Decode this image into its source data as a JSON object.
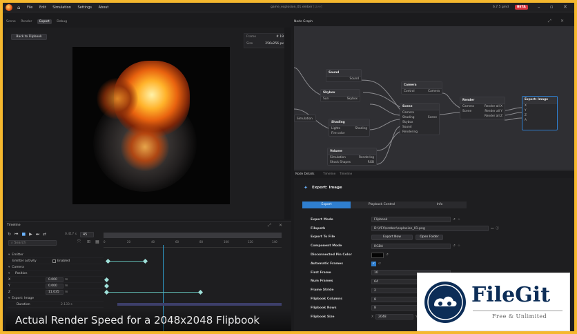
{
  "titlebar": {
    "menu": [
      "File",
      "Edit",
      "Simulation",
      "Settings",
      "About"
    ],
    "file_title": "game_explosion_01.ember",
    "file_suffix": "[Live]",
    "version": "6.7.5 gmd",
    "beta": "BETA"
  },
  "left_tabs": [
    "Scene",
    "Render",
    "Export",
    "Debug"
  ],
  "active_left_tab": "Export",
  "preview": {
    "back_label": "Back to Flipbook",
    "frame_label": "Frame",
    "frame_value": "# 19",
    "size_label": "Size",
    "size_value": "256x256 px"
  },
  "node_graph": {
    "tab": "Node Graph",
    "nodes": {
      "sound": {
        "title": "Sound",
        "rows": [
          "Sound"
        ]
      },
      "skybox": {
        "title": "Skybox",
        "rows": [
          "Sun",
          "Skybox"
        ]
      },
      "camera": {
        "title": "Camera",
        "rows": [
          "Control",
          "Camera"
        ]
      },
      "render": {
        "title": "Render",
        "rows": [
          "Camera",
          "Render all X",
          "Scene",
          "Render all Y",
          "Render all Z"
        ]
      },
      "export_image": {
        "title": "Export: Image",
        "rows": [
          "X",
          "Y",
          "Z",
          "A"
        ]
      },
      "scene": {
        "title": "Scene",
        "rows": [
          "Camera",
          "Shading",
          "Scene",
          "Skybox",
          "Sound",
          "Rendering"
        ]
      },
      "shading": {
        "title": "Shading",
        "rows": [
          "Lights",
          "Shading",
          "Fire color"
        ]
      },
      "volume": {
        "title": "Volume",
        "rows": [
          "Simulation",
          "Rendering",
          "Shock Shapes",
          "RGB"
        ]
      },
      "left_stub": {
        "title": "",
        "rows": [
          "Simulation"
        ]
      }
    }
  },
  "details_tabs": [
    "Node Details",
    "Timeline",
    "Timeline"
  ],
  "details": {
    "header": "Export: Image",
    "tabs": [
      "Export",
      "Playback Control",
      "Info"
    ],
    "rows": [
      {
        "label": "Export Mode",
        "value": "Flipbook"
      },
      {
        "label": "Filepath",
        "value": "D:\\VFX\\ember\\explosion_01.png"
      },
      {
        "label": "Export To File",
        "btn1": "Export Now",
        "btn2": "Open Folder"
      },
      {
        "label": "Component Mode",
        "value": "RGBA"
      },
      {
        "label": "Disconnected Pin Color",
        "value": ""
      },
      {
        "label": "Automatic Frames",
        "value": ""
      },
      {
        "label": "First Frame",
        "value": "10"
      },
      {
        "label": "Num Frames",
        "value": "64"
      },
      {
        "label": "Frame Stride",
        "value": "2"
      },
      {
        "label": "Flipbook Columns",
        "value": "8"
      },
      {
        "label": "Flipbook Rows",
        "value": "8"
      },
      {
        "label": "Flipbook Size",
        "value": "2048",
        "axis_x": "X",
        "axis_y": "Y",
        "value2": "20"
      }
    ]
  },
  "timeline": {
    "title": "Timeline",
    "time": "0.417 s",
    "frame": "45",
    "search_placeholder": "Search",
    "ruler": [
      "0",
      "20",
      "40",
      "60",
      "80",
      "100",
      "120",
      "140"
    ],
    "rows": [
      {
        "name": "Emitter",
        "type": "group"
      },
      {
        "name": "Emitter activity",
        "value": "Enabled",
        "type": "check"
      },
      {
        "name": "Camera",
        "type": "group"
      },
      {
        "name": "Position",
        "type": "sub"
      },
      {
        "name": "X",
        "value": "0.000",
        "unit": "m"
      },
      {
        "name": "Y",
        "value": "0.000",
        "unit": "m"
      },
      {
        "name": "Z",
        "value": "11.035",
        "unit": "m"
      },
      {
        "name": "Export: Image",
        "type": "group"
      },
      {
        "name": "Duration",
        "value": "2.133 s"
      }
    ]
  },
  "caption": "Actual Render Speed for a 2048x2048 Flipbook",
  "watermark": {
    "title": "FileGit",
    "subtitle": "Free & Unlimited"
  },
  "colors": {
    "accent_blue": "#2f7fd0",
    "beta_red": "#d9363e",
    "border_yellow": "#f5b82e",
    "key_teal": "#9fe0d9"
  }
}
